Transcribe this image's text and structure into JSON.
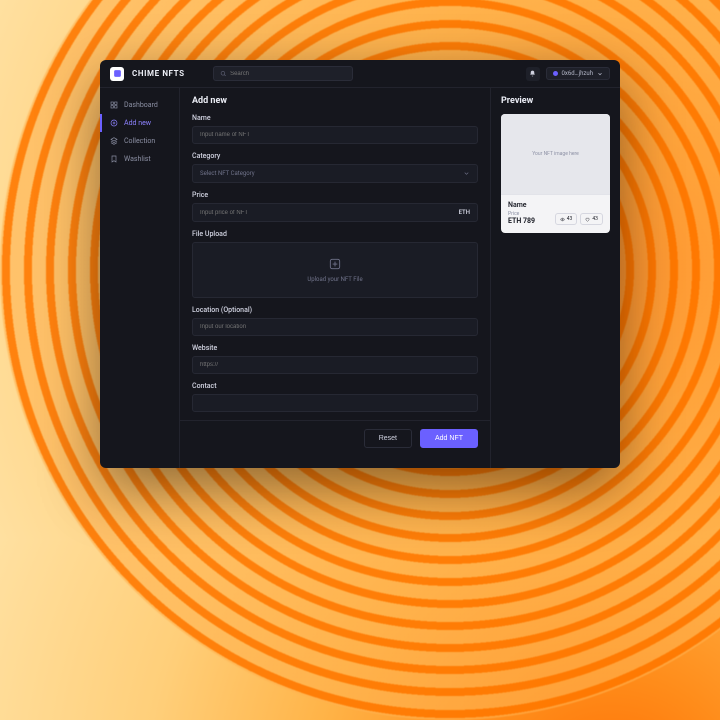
{
  "brand": "CHIME NFTS",
  "search": {
    "placeholder": "Search"
  },
  "user": {
    "name": "0x6d…jhzuh"
  },
  "sidebar": {
    "items": [
      {
        "label": "Dashboard"
      },
      {
        "label": "Add new"
      },
      {
        "label": "Collection"
      },
      {
        "label": "Washlist"
      }
    ]
  },
  "form": {
    "title": "Add new",
    "name": {
      "label": "Name",
      "placeholder": "Input name of NFT"
    },
    "category": {
      "label": "Category",
      "placeholder": "Select NFT Category"
    },
    "price": {
      "label": "Price",
      "placeholder": "Input price of NFT",
      "suffix": "ETH"
    },
    "upload": {
      "label": "File Upload",
      "hint": "Upload your NFT File"
    },
    "location": {
      "label": "Location (Optional)",
      "placeholder": "Input our location"
    },
    "website": {
      "label": "Website",
      "placeholder": "https://"
    },
    "contact": {
      "label": "Contact",
      "placeholder": ""
    },
    "actions": {
      "reset": "Reset",
      "submit": "Add NFT"
    }
  },
  "preview": {
    "title": "Preview",
    "image_placeholder": "Your NFT image here",
    "name_label": "Name",
    "price_label": "Price",
    "price": "ETH 789",
    "views": "43",
    "likes": "43"
  },
  "colors": {
    "accent": "#6b60ff"
  }
}
